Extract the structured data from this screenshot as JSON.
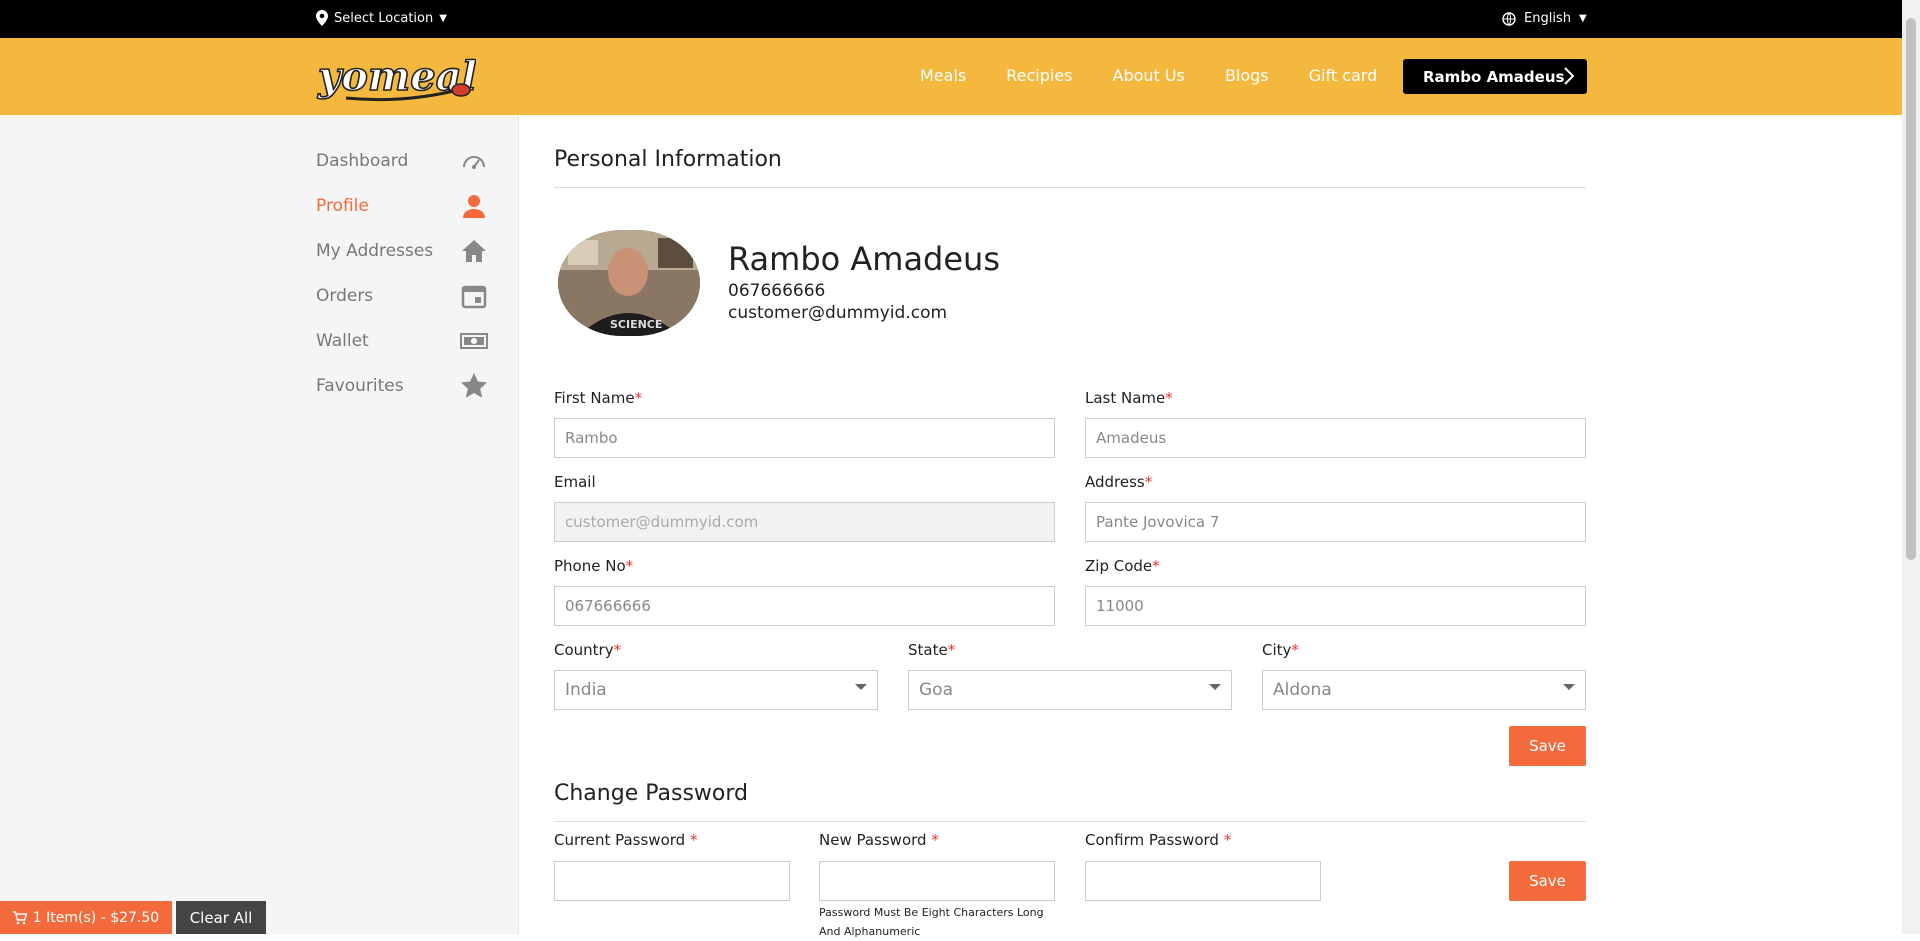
{
  "topbar": {
    "location_label": "Select Location",
    "language": "English"
  },
  "header": {
    "logo_text": "yomeals",
    "nav": [
      "Meals",
      "Recipies",
      "About Us",
      "Blogs",
      "Gift card"
    ],
    "user_name": "Rambo Amadeus"
  },
  "sidebar": {
    "items": [
      {
        "label": "Dashboard",
        "icon": "speedometer-icon"
      },
      {
        "label": "Profile",
        "icon": "user-icon",
        "active": true
      },
      {
        "label": "My Addresses",
        "icon": "home-icon"
      },
      {
        "label": "Orders",
        "icon": "calendar-icon"
      },
      {
        "label": "Wallet",
        "icon": "money-icon"
      },
      {
        "label": "Favourites",
        "icon": "star-icon"
      }
    ]
  },
  "personal": {
    "title": "Personal Information",
    "name": "Rambo Amadeus",
    "phone": "067666666",
    "email": "customer@dummyid.com",
    "fields": {
      "first_name": {
        "label": "First Name",
        "value": "Rambo"
      },
      "last_name": {
        "label": "Last Name",
        "value": "Amadeus"
      },
      "email": {
        "label": "Email",
        "value": "customer@dummyid.com"
      },
      "address": {
        "label": "Address",
        "value": "Pante Jovovica 7"
      },
      "phone": {
        "label": "Phone No",
        "value": "067666666"
      },
      "zip": {
        "label": "Zip Code",
        "value": "11000"
      },
      "country": {
        "label": "Country",
        "value": "India"
      },
      "state": {
        "label": "State",
        "value": "Goa"
      },
      "city": {
        "label": "City",
        "value": "Aldona"
      }
    },
    "save_label": "Save"
  },
  "password": {
    "title": "Change Password",
    "current_label": "Current Password",
    "new_label": "New Password",
    "confirm_label": "Confirm Password",
    "hint": "Password Must Be Eight Characters Long And Alphanumeric",
    "save_label": "Save"
  },
  "cart": {
    "summary": "1 Item(s) - $27.50",
    "clear_label": "Clear All"
  },
  "colors": {
    "accent": "#f36b3c",
    "header": "#f5b83f",
    "topbar": "#000000"
  }
}
